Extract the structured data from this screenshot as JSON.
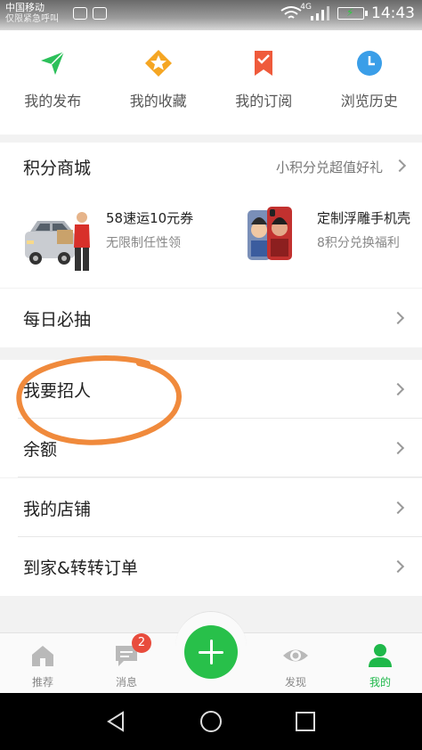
{
  "status_bar": {
    "carrier": "中国移动",
    "carrier_sub": "仅限紧急呼叫",
    "network": "4G",
    "time": "14:43"
  },
  "quick_nav": [
    {
      "label": "我的发布",
      "icon": "send-arrow-icon",
      "color": "#2cc05a"
    },
    {
      "label": "我的收藏",
      "icon": "star-badge-icon",
      "color": "#f5a623"
    },
    {
      "label": "我的订阅",
      "icon": "bookmark-icon",
      "color": "#ef5a3b"
    },
    {
      "label": "浏览历史",
      "icon": "clock-icon",
      "color": "#3a9ee8"
    }
  ],
  "points_mall": {
    "title": "积分商城",
    "subtitle": "小积分兑超值好礼",
    "products": [
      {
        "name": "58速运10元券",
        "desc": "无限制任性领"
      },
      {
        "name": "定制浮雕手机壳",
        "desc": "8积分兑换福利"
      }
    ]
  },
  "menu": {
    "daily_draw": "每日必抽",
    "recruit": "我要招人",
    "balance": "余额",
    "my_store": "我的店铺",
    "orders": "到家&转转订单"
  },
  "bottom_nav": {
    "home": "推荐",
    "messages": "消息",
    "message_badge": "2",
    "discover": "发现",
    "mine": "我的",
    "active_color": "#1fb84a"
  }
}
